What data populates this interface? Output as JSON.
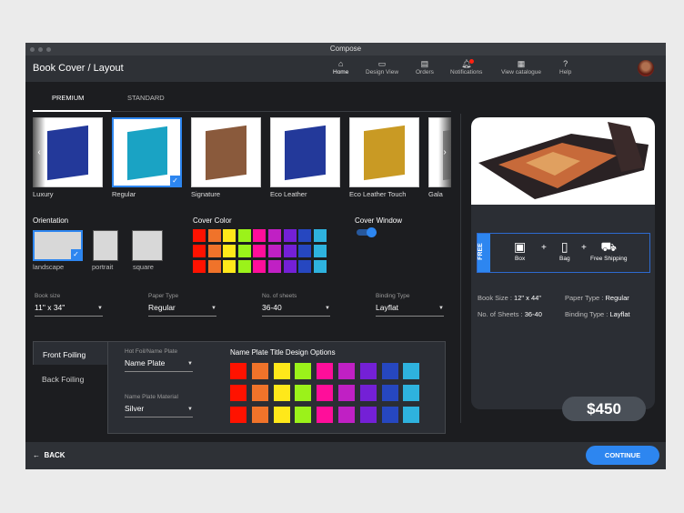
{
  "window": {
    "title": "Compose"
  },
  "header": {
    "title": "Book Cover / Layout",
    "nav": [
      {
        "label": "Home",
        "icon": "home-icon"
      },
      {
        "label": "Design View",
        "icon": "design-view-icon"
      },
      {
        "label": "Orders",
        "icon": "orders-icon"
      },
      {
        "label": "Notifications",
        "icon": "bell-icon"
      },
      {
        "label": "View catalogue",
        "icon": "grid-icon"
      },
      {
        "label": "Help",
        "icon": "help-icon"
      }
    ]
  },
  "tabs": {
    "premium": "PREMIUM",
    "standard": "STANDARD"
  },
  "books": [
    {
      "label": "Luxury",
      "color": "#23399a"
    },
    {
      "label": "Regular",
      "color": "#1aa3c4"
    },
    {
      "label": "Signature",
      "color": "#8a5a3c"
    },
    {
      "label": "Eco Leather",
      "color": "#23399a"
    },
    {
      "label": "Eco Leather Touch",
      "color": "#c99a24"
    },
    {
      "label": "Gala",
      "color": "#999999"
    }
  ],
  "orientation": {
    "title": "Orientation",
    "options": [
      "landscape",
      "portrait",
      "square"
    ],
    "selected": "landscape"
  },
  "cover_color": {
    "title": "Cover Color"
  },
  "cover_window": {
    "title": "Cover Window",
    "enabled": true
  },
  "swatches": [
    "#ff1200",
    "#f0732a",
    "#ffe81a",
    "#9bf21a",
    "#ff0e9a",
    "#c020c4",
    "#7420d6",
    "#2647c0",
    "#2eb2de"
  ],
  "fields": [
    {
      "label": "Book size",
      "value": "11\" x 34\""
    },
    {
      "label": "Paper Type",
      "value": "Regular"
    },
    {
      "label": "No. of sheets",
      "value": "36-40"
    },
    {
      "label": "Binding Type",
      "value": "Layflat"
    }
  ],
  "foiling": {
    "front": "Front Foiling",
    "back": "Back Foiling",
    "hot_foil_label": "Hot Foil/Name Plate",
    "hot_foil_value": "Name Plate",
    "material_label": "Name Plate Material",
    "material_value": "Silver",
    "design_title": "Name Plate Title Design Options"
  },
  "summary": {
    "free": "FREE",
    "items": [
      "Box",
      "Bag",
      "Free Shipping"
    ],
    "book_size_label": "Book Size :",
    "book_size": "12\" x 44\"",
    "paper_label": "Paper Type :",
    "paper": "Regular",
    "sheets_label": "No. of Sheets :",
    "sheets": "36-40",
    "binding_label": "Binding Type :",
    "binding": "Layflat",
    "price": "$450"
  },
  "footer": {
    "back": "BACK",
    "continue": "CONTINUE"
  }
}
